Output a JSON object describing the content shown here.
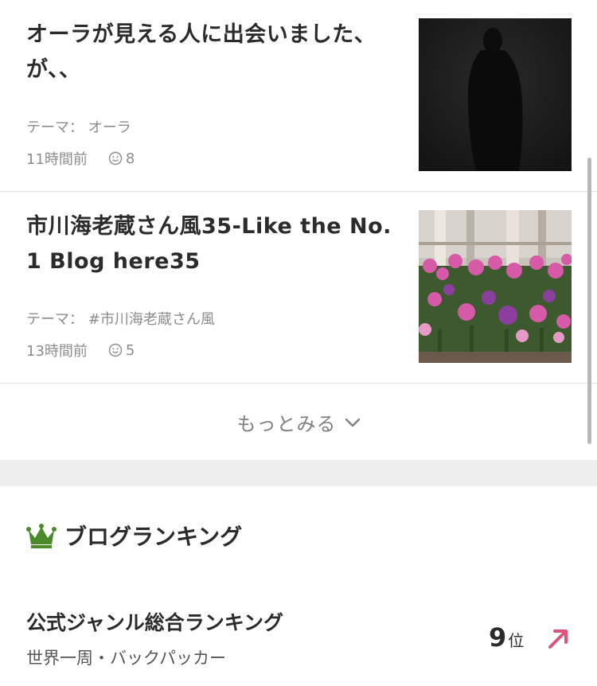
{
  "articles": [
    {
      "title": "オーラが見える人に出会いました、が、、",
      "theme_label": "テーマ：",
      "theme": "オーラ",
      "time": "11時間前",
      "likes": "8",
      "thumb_icon": "shadow-photo"
    },
    {
      "title": "市川海老蔵さん風35-Like the No. 1 Blog here35",
      "theme_label": "テーマ：",
      "theme": "#市川海老蔵さん風",
      "time": "13時間前",
      "likes": "5",
      "thumb_icon": "flowers-photo"
    }
  ],
  "more_label": "もっとみる",
  "ranking": {
    "header": "ブログランキング",
    "title": "公式ジャンル総合ランキング",
    "genre": "世界一周・バックパッカー",
    "position": "9",
    "position_unit": "位",
    "trend_icon": "up-right-arrow-icon"
  },
  "colors": {
    "crown": "#4a8a2a",
    "trend": "#e0527a",
    "divider": "#e2e2e2",
    "gap": "#eeeeee"
  }
}
